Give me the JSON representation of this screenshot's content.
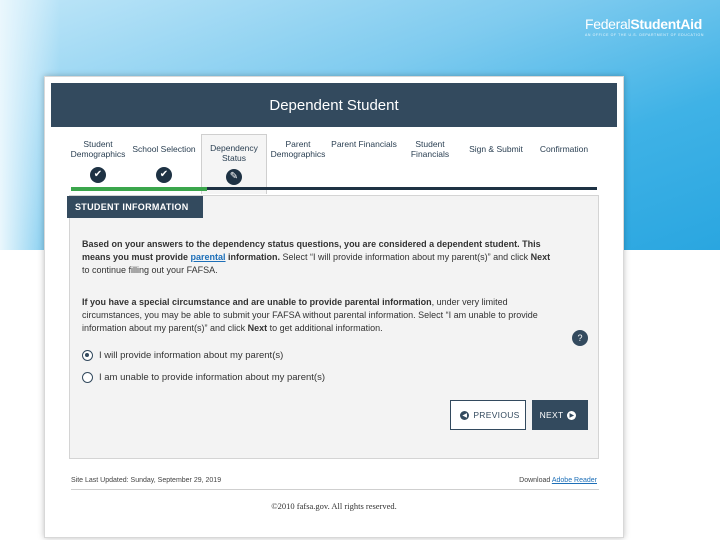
{
  "brand": {
    "logo_part1": "Federal",
    "logo_part2": "StudentAid",
    "tagline": "AN OFFICE OF THE U.S. DEPARTMENT OF EDUCATION"
  },
  "header": {
    "title": "Dependent Student"
  },
  "steps": [
    {
      "label": "Student Demographics",
      "status": "complete",
      "icon": "check-icon"
    },
    {
      "label": "School Selection",
      "status": "complete",
      "icon": "check-icon"
    },
    {
      "label": "Dependency Status",
      "status": "active",
      "icon": "pencil-icon"
    },
    {
      "label": "Parent Demographics",
      "status": "pending"
    },
    {
      "label": "Parent Financials",
      "status": "pending"
    },
    {
      "label": "Student Financials",
      "status": "pending"
    },
    {
      "label": "Sign & Submit",
      "status": "pending"
    },
    {
      "label": "Confirmation",
      "status": "pending"
    }
  ],
  "section": {
    "title": "STUDENT INFORMATION"
  },
  "content": {
    "p1_a": "Based on your answers to the dependency status questions, you are considered a dependent student. This means you must provide ",
    "p1_link": "parental",
    "p1_b": " information.",
    "p1_c": " Select “I will provide information about my parent(s)” and click ",
    "p1_next": "Next",
    "p1_d": " to continue filling out your FAFSA.",
    "p2_bold": "If you have a special circumstance and are unable to provide parental information",
    "p2_a": ", under very limited circumstances, you may be able to submit your FAFSA without parental information. Select “I am unable to provide information about my parent(s)” and click ",
    "p2_next": "Next",
    "p2_b": " to get additional information."
  },
  "options": [
    {
      "label": "I will provide information about my parent(s)",
      "selected": true
    },
    {
      "label": "I am unable to provide information about my parent(s)",
      "selected": false
    }
  ],
  "help_label": "?",
  "buttons": {
    "previous": "PREVIOUS",
    "next": "NEXT"
  },
  "footer": {
    "last_updated": "Site Last Updated: Sunday, September 29, 2019",
    "download_prefix": "Download ",
    "download_link": "Adobe Reader",
    "copyright": "©2010 fafsa.gov. All rights reserved."
  },
  "colors": {
    "header": "#334a5e",
    "progress_complete": "#3ba64c",
    "link": "#1d6fb8",
    "banner": "#3fb2e6"
  }
}
